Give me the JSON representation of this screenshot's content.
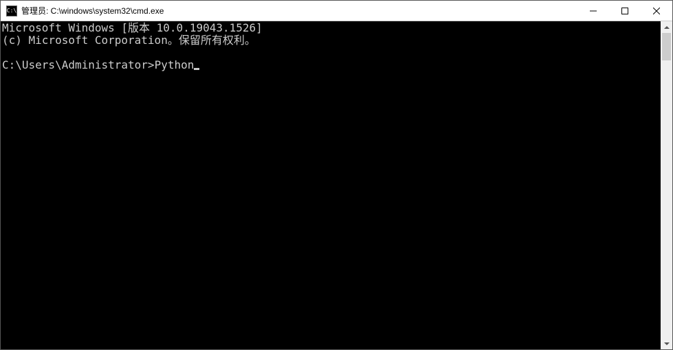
{
  "titlebar": {
    "icon_label": "C:\\",
    "title": "管理员: C:\\windows\\system32\\cmd.exe"
  },
  "console": {
    "line1": "Microsoft Windows [版本 10.0.19043.1526]",
    "line2": "(c) Microsoft Corporation。保留所有权利。",
    "blank": "",
    "prompt": "C:\\Users\\Administrator>",
    "input": "Python"
  }
}
